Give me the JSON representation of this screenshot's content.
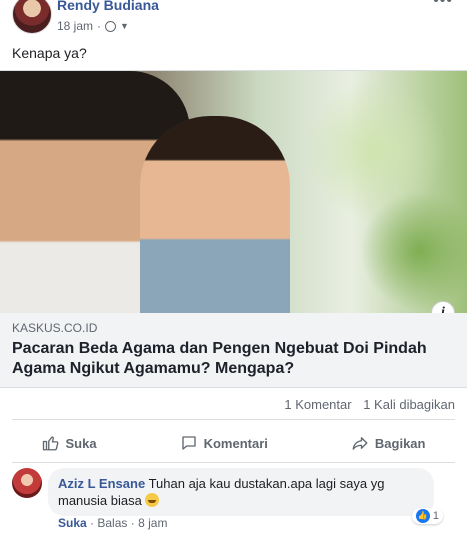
{
  "post": {
    "author": "Rendy Budiana",
    "time": "18 jam",
    "status_text": "Kenapa ya?",
    "more_icon": "more-horizontal-icon",
    "privacy_icon": "globe-icon"
  },
  "link": {
    "domain": "KASKUS.CO.ID",
    "title": "Pacaran Beda Agama dan Pengen Ngebuat Doi Pindah Agama Ngikut Agamamu? Mengapa?",
    "info_glyph": "i"
  },
  "counts": {
    "comments": "1 Komentar",
    "shares": "1 Kali dibagikan"
  },
  "actions": {
    "like": "Suka",
    "comment": "Komentari",
    "share": "Bagikan"
  },
  "comment": {
    "author": "Aziz L Ensane",
    "text": "Tuhan aja kau dustakan.apa lagi saya yg manusia biasa",
    "like_label": "Suka",
    "reply_label": "Balas",
    "separator": "·",
    "time": "8 jam",
    "reaction_count": "1"
  },
  "colors": {
    "link_blue": "#385898",
    "muted": "#606770",
    "like_blue": "#1877f2",
    "bubble_bg": "#f2f3f5"
  }
}
